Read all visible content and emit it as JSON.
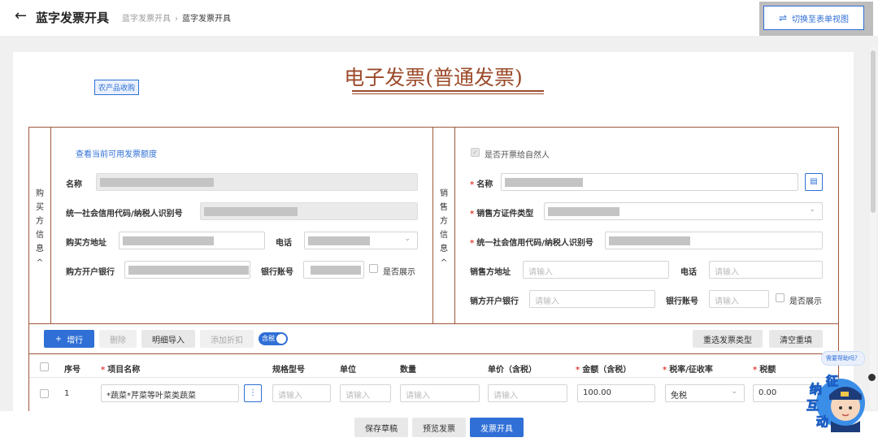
{
  "header": {
    "back_icon": "arrow-left-icon",
    "title": "蓝字发票开具",
    "breadcrumb": [
      "蓝字发票开具",
      "蓝字发票开具"
    ],
    "switch_view": "切换至表单视图",
    "switch_icon": "swap-icon"
  },
  "invoice": {
    "tag": "农产品收购",
    "title": "电子发票(普通发票)",
    "title_color": "#9c4a2a"
  },
  "buyer": {
    "section_label": [
      "购",
      "买",
      "方",
      "信",
      "息",
      "^"
    ],
    "query_link": "查看当前可用发票额度",
    "name_label": "名称",
    "credit_code_label": "统一社会信用代码/纳税人识别号",
    "address_label": "购买方地址",
    "phone_label": "电话",
    "bank_label": "购方开户银行",
    "account_label": "银行账号",
    "show_label": "是否展示"
  },
  "seller": {
    "section_label": [
      "销",
      "售",
      "方",
      "信",
      "息",
      "^"
    ],
    "natural_person_label": "是否开票给自然人",
    "name_label": "名称",
    "cert_type_label": "销售方证件类型",
    "credit_code_label": "统一社会信用代码/纳税人识别号",
    "address_label": "销售方地址",
    "address_placeholder": "请输入",
    "phone_label": "电话",
    "phone_placeholder": "请输入",
    "bank_label": "销方开户银行",
    "bank_placeholder": "请输入",
    "account_label": "银行账号",
    "account_placeholder": "请输入",
    "show_label": "是否展示"
  },
  "toolbar": {
    "add_row": "增行",
    "delete": "删除",
    "import_detail": "明细导入",
    "add_discount": "添加折扣",
    "tax_included": "含税",
    "reselect_type": "重选发票类型",
    "clear_refill": "清空重填"
  },
  "table": {
    "headers": {
      "seq": "序号",
      "item_name": "项目名称",
      "spec": "规格型号",
      "unit": "单位",
      "quantity": "数量",
      "unit_price": "单价（含税）",
      "amount": "金额（含税）",
      "tax_rate": "税率/征收率",
      "tax": "税额"
    },
    "rows": [
      {
        "seq": "1",
        "item_name": "*蔬菜*芹菜等叶菜类蔬菜",
        "spec": "请输入",
        "unit": "请输入",
        "quantity": "请输入",
        "unit_price": "请输入",
        "amount": "100.00",
        "tax_rate": "免税",
        "tax": "0.00"
      }
    ]
  },
  "footer": {
    "save_draft": "保存草稿",
    "preview": "预览发票",
    "issue": "发票开具"
  },
  "assistant": {
    "bubble": "需要帮助吗？",
    "chars": [
      "征",
      "纳",
      "互",
      "动"
    ]
  },
  "colors": {
    "primary": "#2f6fd6",
    "border": "#a0583c",
    "required": "#e0463b"
  }
}
